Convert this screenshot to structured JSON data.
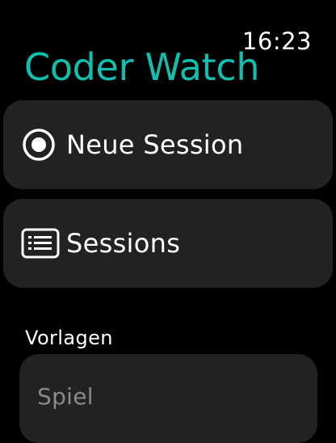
{
  "status": {
    "time": "16:23"
  },
  "app": {
    "title": "Coder Watch",
    "accent_color": "#11bfae"
  },
  "menu": [
    {
      "label": "Neue Session",
      "icon": "radio-target-icon"
    },
    {
      "label": "Sessions",
      "icon": "list-icon"
    }
  ],
  "templates": {
    "header": "Vorlagen",
    "items": [
      {
        "label": "Spiel"
      }
    ]
  }
}
